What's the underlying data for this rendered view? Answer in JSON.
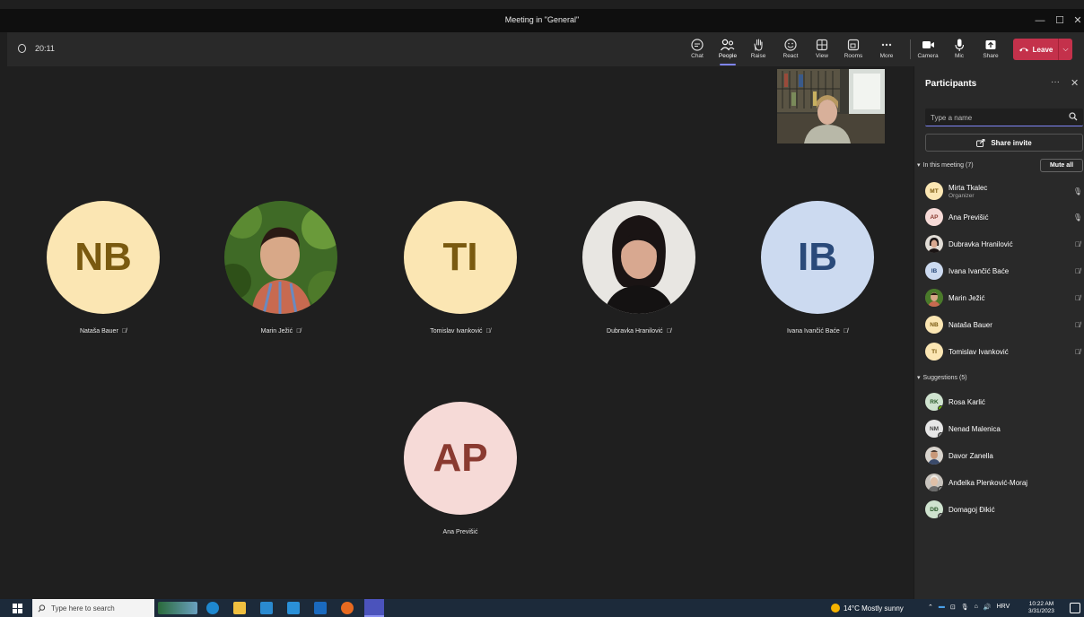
{
  "window": {
    "title": "Meeting in \"General\""
  },
  "toolbar": {
    "timer": "20:11",
    "buttons": [
      {
        "label": "Chat",
        "icon": "chat-icon"
      },
      {
        "label": "People",
        "icon": "people-icon",
        "active": true
      },
      {
        "label": "Raise",
        "icon": "hand-icon"
      },
      {
        "label": "React",
        "icon": "smile-icon"
      },
      {
        "label": "View",
        "icon": "grid-icon"
      },
      {
        "label": "Rooms",
        "icon": "rooms-icon"
      },
      {
        "label": "More",
        "icon": "more-icon"
      },
      {
        "label": "Camera",
        "icon": "camera-icon"
      },
      {
        "label": "Mic",
        "icon": "mic-icon"
      },
      {
        "label": "Share",
        "icon": "share-icon"
      }
    ],
    "leave_label": "Leave"
  },
  "stage": {
    "tiles": [
      {
        "initials": "NB",
        "name": "Nataša Bauer",
        "bg": "#fbe6b3",
        "fg": "#7a5a10"
      },
      {
        "initials": "",
        "name": "Marin Ježić",
        "photo": true
      },
      {
        "initials": "TI",
        "name": "Tomislav Ivanković",
        "bg": "#fbe6b3",
        "fg": "#7a5a10"
      },
      {
        "initials": "",
        "name": "Dubravka Hranilović",
        "photo": true
      },
      {
        "initials": "IB",
        "name": "Ivana Ivančić Baće",
        "bg": "#ccdaf0",
        "fg": "#2a4a7a"
      },
      {
        "initials": "AP",
        "name": "Ana Previšić",
        "bg": "#f6dad7",
        "fg": "#8a3a30"
      }
    ]
  },
  "panel": {
    "title": "Participants",
    "search_placeholder": "Type a name",
    "share_invite": "Share invite",
    "in_meeting_label": "In this meeting (7)",
    "mute_all": "Mute all",
    "suggestions_label": "Suggestions (5)",
    "participants": [
      {
        "initials": "MT",
        "name": "Mirta Tkalec",
        "role": "Organizer",
        "bg": "#fbe6b3",
        "fg": "#7a5a10",
        "mic": "on"
      },
      {
        "initials": "AP",
        "name": "Ana Previšić",
        "role": "",
        "bg": "#f6dad7",
        "fg": "#8a3a30",
        "mic": "on"
      },
      {
        "initials": "",
        "name": "Dubravka Hranilović",
        "role": "",
        "photo": "#6e6050",
        "mic": "off"
      },
      {
        "initials": "IB",
        "name": "Ivana Ivančić Baće",
        "role": "",
        "bg": "#ccdaf0",
        "fg": "#2a4a7a",
        "mic": "off"
      },
      {
        "initials": "",
        "name": "Marin Ježić",
        "role": "",
        "photo": "#5b7a3a",
        "mic": "off"
      },
      {
        "initials": "NB",
        "name": "Nataša Bauer",
        "role": "",
        "bg": "#fbe6b3",
        "fg": "#7a5a10",
        "mic": "off"
      },
      {
        "initials": "TI",
        "name": "Tomislav Ivanković",
        "role": "",
        "bg": "#fbe6b3",
        "fg": "#7a5a10",
        "mic": "off"
      }
    ],
    "suggestions": [
      {
        "initials": "RK",
        "name": "Rosa Karlić",
        "bg": "#cfe3cf",
        "fg": "#2a5a2a"
      },
      {
        "initials": "NM",
        "name": "Nenad Malenica",
        "bg": "#e6e6e6",
        "fg": "#444444"
      },
      {
        "initials": "",
        "name": "Davor Zanella",
        "photo": "#8a7060"
      },
      {
        "initials": "",
        "name": "Anđelka Plenković-Moraj",
        "photo": "#a09080"
      },
      {
        "initials": "DĐ",
        "name": "Domagoj Đikić",
        "bg": "#cfe3cf",
        "fg": "#2a5a2a"
      }
    ]
  },
  "taskbar": {
    "search_placeholder": "Type here to search",
    "weather": "14°C  Mostly sunny",
    "lang": "HRV",
    "time": "10:22 AM",
    "date": "3/31/2023"
  },
  "colors": {
    "accent": "#7f85f5",
    "leave": "#c4314b",
    "panel": "#292929",
    "stage": "#1f1f1f"
  }
}
